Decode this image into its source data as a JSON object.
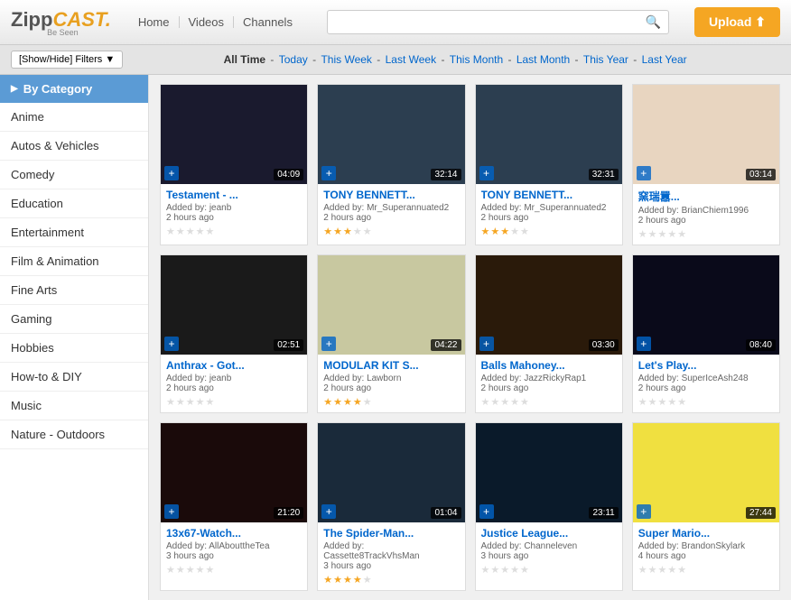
{
  "logo": {
    "zipp": "Zipp",
    "cast": "CAST.",
    "sub": "Be Seen"
  },
  "nav": {
    "items": [
      "Home",
      "Videos",
      "Channels"
    ]
  },
  "search": {
    "placeholder": ""
  },
  "upload": {
    "label": "Upload ⬆"
  },
  "filter": {
    "button_label": "[Show/Hide] Filters ▼"
  },
  "time_filters": {
    "all_time": "All Time",
    "separator": " - ",
    "items": [
      "Today",
      "This Week",
      "Last Week",
      "This Month",
      "Last Month",
      "This Year",
      "Last Year"
    ]
  },
  "sidebar": {
    "header": "By Category",
    "items": [
      "Anime",
      "Autos & Vehicles",
      "Comedy",
      "Education",
      "Entertainment",
      "Film & Animation",
      "Fine Arts",
      "Gaming",
      "Hobbies",
      "How-to & DIY",
      "Music",
      "Nature - Outdoors"
    ]
  },
  "videos": [
    {
      "title": "Testament - ...",
      "added_by": "jeanb",
      "time_ago": "2 hours ago",
      "duration": "04:09",
      "stars": 0,
      "thumb_class": "thumb-dark"
    },
    {
      "title": "TONY BENNETT...",
      "added_by": "Mr_Superannuated2",
      "time_ago": "2 hours ago",
      "duration": "32:14",
      "stars": 3,
      "thumb_class": "thumb-album"
    },
    {
      "title": "TONY BENNETT...",
      "added_by": "Mr_Superannuated2",
      "time_ago": "2 hours ago",
      "duration": "32:31",
      "stars": 3,
      "thumb_class": "thumb-album"
    },
    {
      "title": "窯瑞囂...",
      "added_by": "BrianChiem1996",
      "time_ago": "2 hours ago",
      "duration": "03:14",
      "stars": 0,
      "thumb_class": "thumb-pale"
    },
    {
      "title": "Anthrax - Got...",
      "added_by": "jeanb",
      "time_ago": "2 hours ago",
      "duration": "02:51",
      "stars": 0,
      "thumb_class": "thumb-band"
    },
    {
      "title": "MODULAR KIT S...",
      "added_by": "Lawborn",
      "time_ago": "2 hours ago",
      "duration": "04:22",
      "stars": 4,
      "thumb_class": "thumb-kitchen"
    },
    {
      "title": "Balls Mahoney...",
      "added_by": "JazzRickyRap1",
      "time_ago": "2 hours ago",
      "duration": "03:30",
      "stars": 0,
      "thumb_class": "thumb-wrestler"
    },
    {
      "title": "Let's Play...",
      "added_by": "SuperIceAsh248",
      "time_ago": "2 hours ago",
      "duration": "08:40",
      "stars": 0,
      "thumb_class": "thumb-game"
    },
    {
      "title": "13x67-Watch...",
      "added_by": "AllAbouttheTea",
      "time_ago": "3 hours ago",
      "duration": "21:20",
      "stars": 0,
      "thumb_class": "thumb-show"
    },
    {
      "title": "The Spider-Man...",
      "added_by": "Cassette8TrackVhsMan",
      "time_ago": "3 hours ago",
      "duration": "01:04",
      "stars": 4,
      "thumb_class": "thumb-charles"
    },
    {
      "title": "Justice League...",
      "added_by": "Channeleven",
      "time_ago": "3 hours ago",
      "duration": "23:11",
      "stars": 0,
      "thumb_class": "thumb-justice"
    },
    {
      "title": "Super Mario...",
      "added_by": "BrandonSkylark",
      "time_ago": "4 hours ago",
      "duration": "27:44",
      "stars": 0,
      "thumb_class": "thumb-mario"
    }
  ]
}
